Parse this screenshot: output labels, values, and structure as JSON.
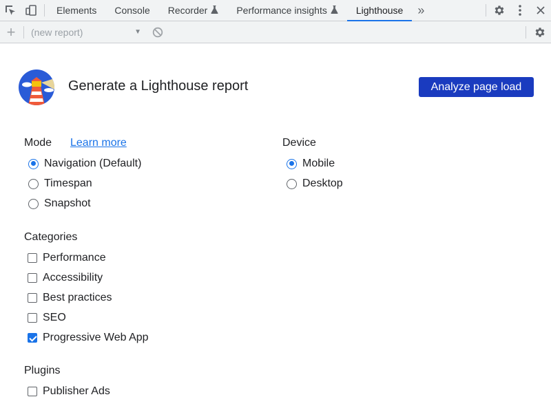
{
  "tabs": [
    {
      "label": "Elements",
      "active": false
    },
    {
      "label": "Console",
      "active": false
    },
    {
      "label": "Recorder",
      "active": false,
      "flask": true
    },
    {
      "label": "Performance insights",
      "active": false,
      "flask": true
    },
    {
      "label": "Lighthouse",
      "active": true
    }
  ],
  "toolbar": {
    "more_tabs": "»",
    "add": "+",
    "report_placeholder": "(new report)",
    "dropdown_arrow": "▼"
  },
  "header": {
    "title": "Generate a Lighthouse report",
    "analyze_label": "Analyze page load"
  },
  "mode": {
    "label": "Mode",
    "learn_more": "Learn more",
    "options": [
      {
        "label": "Navigation (Default)",
        "checked": true
      },
      {
        "label": "Timespan",
        "checked": false
      },
      {
        "label": "Snapshot",
        "checked": false
      }
    ]
  },
  "device": {
    "label": "Device",
    "options": [
      {
        "label": "Mobile",
        "checked": true
      },
      {
        "label": "Desktop",
        "checked": false
      }
    ]
  },
  "categories": {
    "label": "Categories",
    "options": [
      {
        "label": "Performance",
        "checked": false
      },
      {
        "label": "Accessibility",
        "checked": false
      },
      {
        "label": "Best practices",
        "checked": false
      },
      {
        "label": "SEO",
        "checked": false
      },
      {
        "label": "Progressive Web App",
        "checked": true
      }
    ]
  },
  "plugins": {
    "label": "Plugins",
    "options": [
      {
        "label": "Publisher Ads",
        "checked": false
      }
    ]
  },
  "colors": {
    "accent": "#1a73e8",
    "button": "#1a3bbf"
  }
}
